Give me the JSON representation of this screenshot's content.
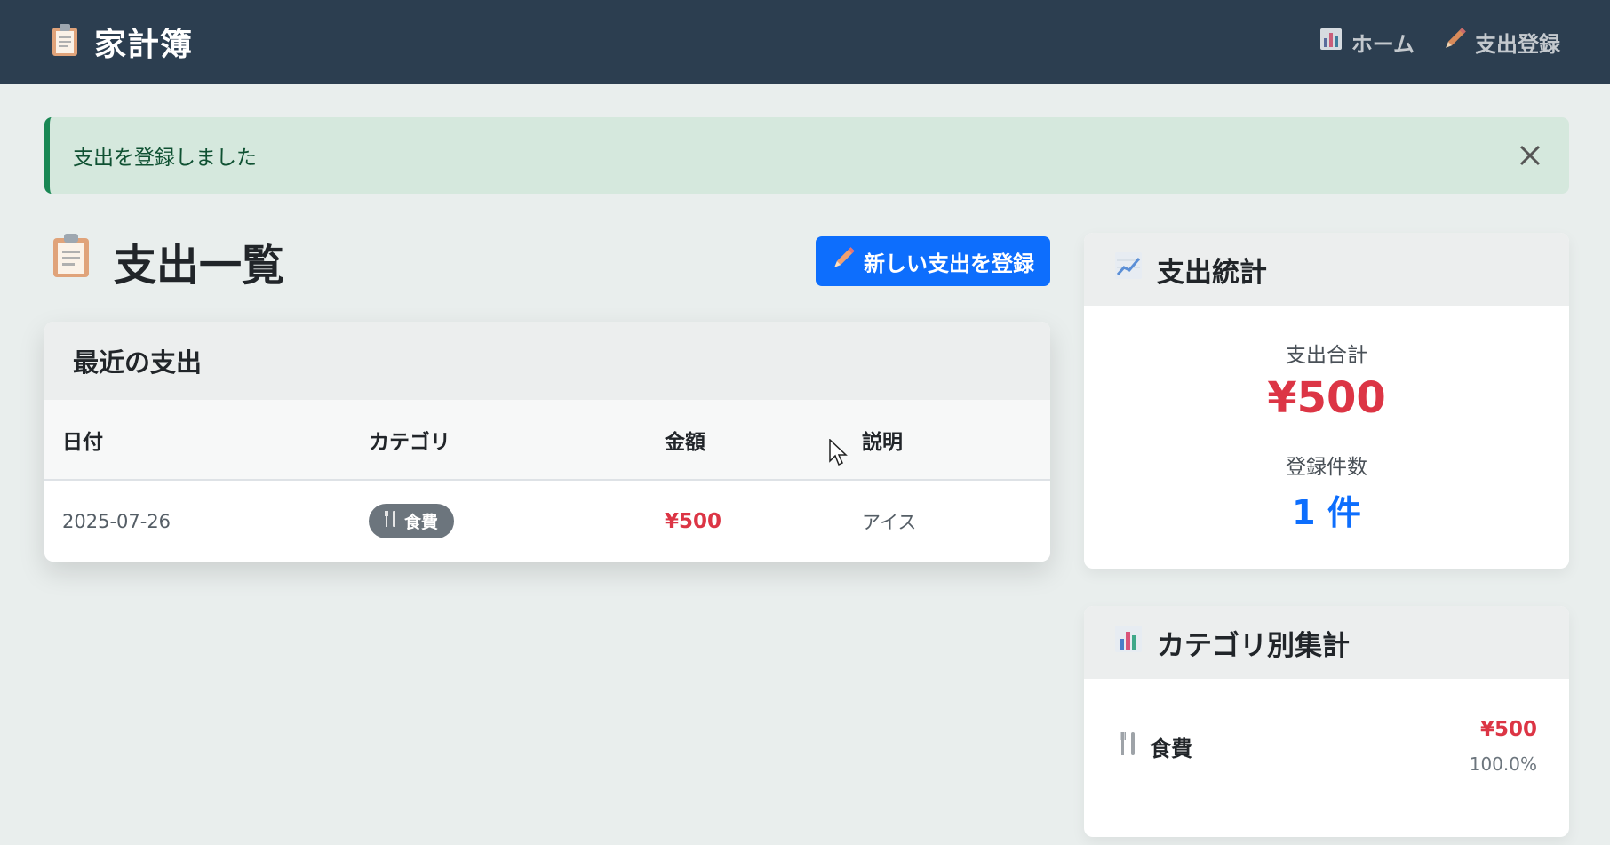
{
  "app": {
    "brand_title": "家計簿",
    "brand_icon": "clipboard-icon"
  },
  "nav": {
    "items": [
      {
        "label": "ホーム",
        "icon": "bar-chart-icon"
      },
      {
        "label": "支出登録",
        "icon": "pencil-icon"
      }
    ]
  },
  "alert": {
    "message": "支出を登録しました",
    "close_icon": "close-icon"
  },
  "page": {
    "title": "支出一覧",
    "title_icon": "clipboard-icon",
    "new_button_label": "新しい支出を登録"
  },
  "recent": {
    "title": "最近の支出",
    "columns": [
      "日付",
      "カテゴリ",
      "金額",
      "説明"
    ],
    "rows": [
      {
        "date": "2025-07-26",
        "category": "食費",
        "category_icon": "fork-knife-icon",
        "amount": "¥500",
        "description": "アイス"
      }
    ]
  },
  "stats": {
    "title": "支出統計",
    "icon": "chart-increasing-icon",
    "total_label": "支出合計",
    "total_value": "¥500",
    "count_label": "登録件数",
    "count_value": "1 件"
  },
  "category_summary": {
    "title": "カテゴリ別集計",
    "icon": "bar-chart-icon",
    "items": [
      {
        "name": "食費",
        "icon": "fork-knife-icon",
        "amount": "¥500",
        "percent": "100.0%"
      }
    ]
  },
  "colors": {
    "navbar": "#2c3e50",
    "primary": "#0d6efd",
    "danger": "#dc3545",
    "success_bg": "#d5e8dd",
    "badge": "#6c757d"
  }
}
